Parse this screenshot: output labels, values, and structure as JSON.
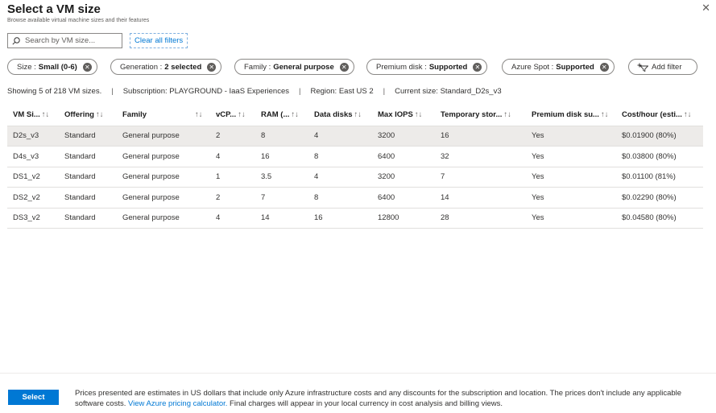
{
  "header": {
    "title": "Select a VM size",
    "subtitle": "Browse available virtual machine sizes and their features"
  },
  "search": {
    "placeholder": "Search by VM size...",
    "value": ""
  },
  "clear_all_label": "Clear all filters",
  "filters": [
    {
      "label": "Size :",
      "value": "Small (0-6)"
    },
    {
      "label": "Generation :",
      "value": "2 selected"
    },
    {
      "label": "Family :",
      "value": "General purpose"
    },
    {
      "label": "Premium disk :",
      "value": "Supported"
    },
    {
      "label": "Azure Spot :",
      "value": "Supported"
    }
  ],
  "add_filter_label": "Add filter",
  "info": {
    "showing": "Showing 5 of 218 VM sizes.",
    "subscription": "Subscription: PLAYGROUND - IaaS Experiences",
    "region": "Region: East US 2",
    "current_size": "Current size: Standard_D2s_v3"
  },
  "table": {
    "columns": [
      {
        "label": "VM Si...",
        "sort": "↑↓"
      },
      {
        "label": "Offering",
        "sort": "↑↓"
      },
      {
        "label": "Family",
        "sort": ""
      },
      {
        "label": "",
        "sort": "↑↓"
      },
      {
        "label": "vCP...",
        "sort": "↑↓"
      },
      {
        "label": "RAM (...",
        "sort": "↑↓"
      },
      {
        "label": "Data disks",
        "sort": "↑↓"
      },
      {
        "label": "Max IOPS",
        "sort": "↑↓"
      },
      {
        "label": "Temporary stor...",
        "sort": "↑↓"
      },
      {
        "label": "Premium disk su...",
        "sort": "↑↓"
      },
      {
        "label": "Cost/hour (esti...",
        "sort": "↑↓"
      }
    ],
    "rows": [
      [
        "D2s_v3",
        "Standard",
        "General purpose",
        "",
        "2",
        "8",
        "4",
        "3200",
        "16",
        "Yes",
        "$0.01900 (80%)"
      ],
      [
        "D4s_v3",
        "Standard",
        "General purpose",
        "",
        "4",
        "16",
        "8",
        "6400",
        "32",
        "Yes",
        "$0.03800 (80%)"
      ],
      [
        "DS1_v2",
        "Standard",
        "General purpose",
        "",
        "1",
        "3.5",
        "4",
        "3200",
        "7",
        "Yes",
        "$0.01100 (81%)"
      ],
      [
        "DS2_v2",
        "Standard",
        "General purpose",
        "",
        "2",
        "7",
        "8",
        "6400",
        "14",
        "Yes",
        "$0.02290 (80%)"
      ],
      [
        "DS3_v2",
        "Standard",
        "General purpose",
        "",
        "4",
        "14",
        "16",
        "12800",
        "28",
        "Yes",
        "$0.04580 (80%)"
      ]
    ],
    "selected_row": 0
  },
  "footer": {
    "select_label": "Select",
    "notice_before": "Prices presented are estimates in US dollars that include only Azure infrastructure costs and any discounts for the subscription and location. The prices don't include any applicable software costs.",
    "notice_link": "View Azure pricing calculator.",
    "notice_after": "Final charges will appear in your local currency in cost analysis and billing views."
  },
  "colors": {
    "accent": "#0078d4",
    "selected_row": "#edebe9",
    "border": "#8a8886"
  }
}
